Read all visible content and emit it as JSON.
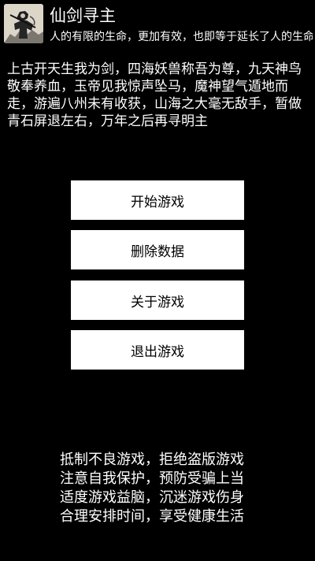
{
  "header": {
    "avatar_icon": "ink-painting-swordsman-icon",
    "title": "仙剑寻主",
    "slogan": "人的有限的生命，更加有效，也即等于延长了人的生命"
  },
  "intro": {
    "text": "上古开天生我为剑，四海妖兽称吾为尊，九天神鸟敬奉养血，玉帝见我惊声坠马，魔神望气遁地而走，游遍八州未有收获，山海之大毫无敌手，暂做青石屏退左右，万年之后再寻明主"
  },
  "menu": {
    "items": [
      {
        "label": "开始游戏"
      },
      {
        "label": "删除数据"
      },
      {
        "label": "关于游戏"
      },
      {
        "label": "退出游戏"
      }
    ]
  },
  "notice": {
    "lines": [
      "抵制不良游戏，拒绝盗版游戏",
      "注意自我保护，预防受骗上当",
      "适度游戏益脑，沉迷游戏伤身",
      "合理安排时间，享受健康生活"
    ]
  },
  "colors": {
    "background": "#000000",
    "text": "#ffffff",
    "button_background": "#ffffff",
    "button_text": "#000000"
  }
}
